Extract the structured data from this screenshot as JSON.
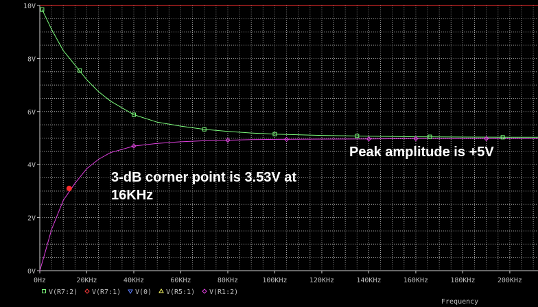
{
  "chart_data": {
    "type": "line",
    "xlabel": "Frequency",
    "ylabel": "",
    "xlim": [
      0,
      212000
    ],
    "ylim": [
      0,
      10
    ],
    "x_ticks": [
      0,
      20000,
      40000,
      60000,
      80000,
      100000,
      120000,
      140000,
      160000,
      180000,
      200000
    ],
    "x_tick_labels": [
      "0Hz",
      "20KHz",
      "40KHz",
      "60KHz",
      "80KHz",
      "100KHz",
      "120KHz",
      "140KHz",
      "160KHz",
      "180KHz",
      "200KHz"
    ],
    "y_ticks": [
      0,
      2,
      4,
      6,
      8,
      10
    ],
    "y_tick_labels": [
      "0V",
      "2V",
      "4V",
      "6V",
      "8V",
      "10V"
    ],
    "grid": true,
    "legend_position": "bottom-left",
    "legend": [
      {
        "label": "V(R7:2)",
        "marker": "square",
        "color": "#7cfc7c"
      },
      {
        "label": "V(R7:1)",
        "marker": "diamond",
        "color": "#ff3b3b"
      },
      {
        "label": "V(0)",
        "marker": "triangle-down",
        "color": "#5a7cff"
      },
      {
        "label": "V(R5:1)",
        "marker": "triangle-up",
        "color": "#ffff66"
      },
      {
        "label": "V(R1:2)",
        "marker": "diamond",
        "color": "#e040e0"
      }
    ],
    "series": [
      {
        "name": "V(R7:2)",
        "color": "#7cfc7c",
        "marker": "square",
        "x": [
          1000,
          5000,
          10000,
          15000,
          20000,
          25000,
          30000,
          40000,
          50000,
          60000,
          70000,
          80000,
          90000,
          100000,
          120000,
          140000,
          160000,
          180000,
          200000,
          212000
        ],
        "y": [
          9.85,
          9.1,
          8.3,
          7.75,
          7.2,
          6.75,
          6.4,
          5.88,
          5.6,
          5.45,
          5.33,
          5.25,
          5.19,
          5.15,
          5.1,
          5.07,
          5.05,
          5.04,
          5.03,
          5.03
        ],
        "marker_x": [
          1000,
          17000,
          40000,
          70000,
          100000,
          135000,
          166000,
          197000
        ],
        "marker_y": [
          9.85,
          7.55,
          5.88,
          5.33,
          5.15,
          5.08,
          5.05,
          5.03
        ]
      },
      {
        "name": "V(R1:2)",
        "color": "#e040e0",
        "marker": "diamond",
        "x": [
          0,
          2000,
          5000,
          10000,
          15000,
          20000,
          25000,
          30000,
          40000,
          50000,
          60000,
          70000,
          80000,
          90000,
          100000,
          120000,
          140000,
          160000,
          180000,
          200000,
          212000
        ],
        "y": [
          0,
          0.6,
          1.55,
          2.65,
          3.3,
          3.85,
          4.2,
          4.45,
          4.7,
          4.8,
          4.86,
          4.9,
          4.92,
          4.94,
          4.95,
          4.96,
          4.97,
          4.98,
          4.98,
          4.98,
          4.98
        ],
        "marker_x": [
          40000,
          80000,
          105000,
          140000,
          160000,
          190000
        ],
        "marker_y": [
          4.7,
          4.92,
          4.95,
          4.97,
          4.98,
          4.98
        ]
      }
    ],
    "highlight_points": [
      {
        "x": 12500,
        "y": 3.1,
        "color": "#ff2a2a"
      }
    ],
    "annotations": [
      {
        "id": "corner",
        "text": "3-dB corner point is 3.53V at\n16KHz"
      },
      {
        "id": "peak",
        "text": "Peak amplitude is +5V"
      }
    ]
  }
}
